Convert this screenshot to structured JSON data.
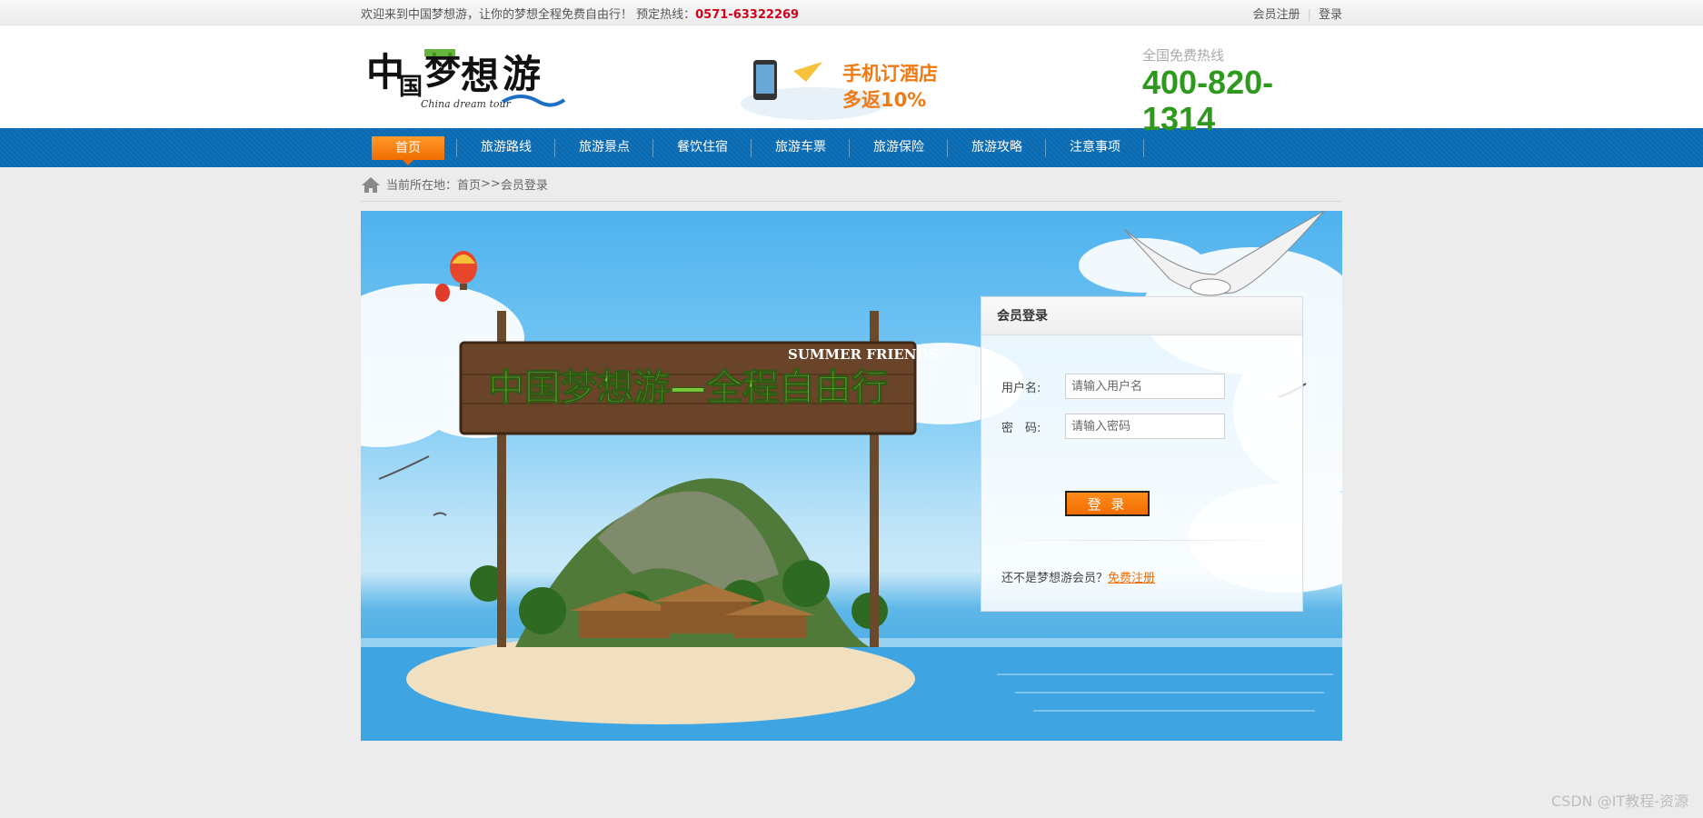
{
  "topbar": {
    "welcome": "欢迎来到中国梦想游，让你的梦想全程免费自由行！ 预定热线：",
    "hotline": "0571-63322269",
    "register": "会员注册",
    "login": "登录"
  },
  "header": {
    "logo_text": "中国梦想游",
    "logo_sub": "China dream tour",
    "promo_line1": "手机订酒店",
    "promo_line2": "多返10%",
    "hotline_label": "全国免费热线",
    "hotline_number": "400-820-1314"
  },
  "nav": {
    "items": [
      "首页",
      "旅游路线",
      "旅游景点",
      "餐饮住宿",
      "旅游车票",
      "旅游保险",
      "旅游攻略",
      "注意事项"
    ]
  },
  "breadcrumb": {
    "prefix": "当前所在地：",
    "home": "首页",
    "sep": " >> ",
    "current": "会员登录"
  },
  "banner": {
    "sign_title": "中国梦想游—全程自由行",
    "sign_sub": "SUMMER FRIENDS"
  },
  "login": {
    "title": "会员登录",
    "username_label": "用户名:",
    "username_placeholder": "请输入用户名",
    "password_label": "密　码:",
    "password_placeholder": "请输入密码",
    "submit": "登 录",
    "not_member": "还不是梦想游会员？",
    "register_link": "免费注册"
  },
  "watermark": "CSDN @IT教程-资源",
  "colors": {
    "nav_bg": "#0a6cb5",
    "accent": "#f06d00",
    "hotline_green": "#2e9a1d",
    "hot_red": "#d0021b"
  }
}
